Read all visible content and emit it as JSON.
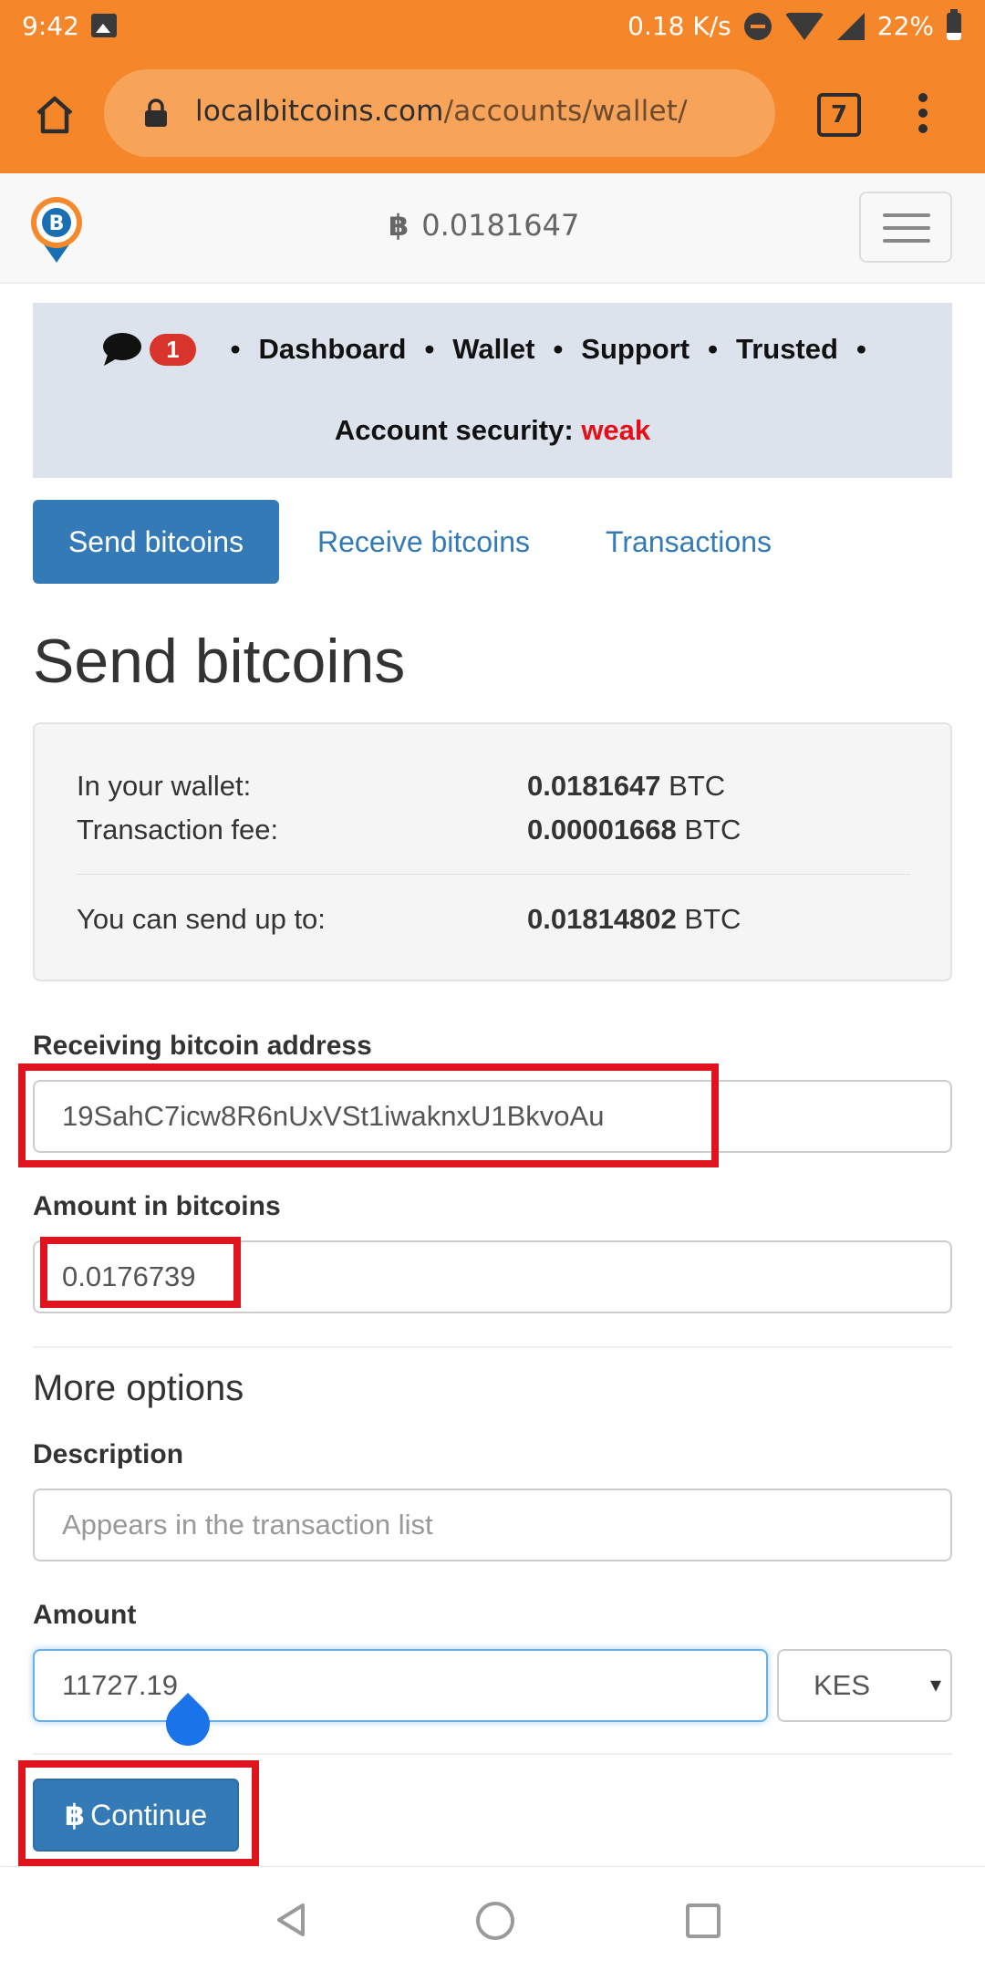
{
  "status_bar": {
    "time": "9:42",
    "net_speed": "0.18 K/s",
    "battery": "22%"
  },
  "browser": {
    "url_host": "localbitcoins.com",
    "url_path": "/accounts/wallet/",
    "tab_count": "7"
  },
  "navbar": {
    "balance_symbol": "฿",
    "balance": "0.0181647"
  },
  "info_nav": {
    "message_count": "1",
    "links": [
      "Dashboard",
      "Wallet",
      "Support",
      "Trusted"
    ],
    "security_label": "Account security:",
    "security_value": "weak"
  },
  "tabs": [
    {
      "label": "Send bitcoins",
      "active": true
    },
    {
      "label": "Receive bitcoins",
      "active": false
    },
    {
      "label": "Transactions",
      "active": false
    }
  ],
  "page_title": "Send bitcoins",
  "wallet_summary": {
    "in_wallet_label": "In your wallet:",
    "in_wallet_value": "0.0181647",
    "fee_label": "Transaction fee:",
    "fee_value": "0.00001668",
    "send_up_to_label": "You can send up to:",
    "send_up_to_value": "0.01814802",
    "unit": "BTC"
  },
  "form": {
    "address_label": "Receiving bitcoin address",
    "address_value": "19SahC7icw8R6nUxVSt1iwaknxU1BkvoAu",
    "amount_btc_label": "Amount in bitcoins",
    "amount_btc_value": "0.0176739",
    "more_options": "More options",
    "description_label": "Description",
    "description_placeholder": "Appears in the transaction list",
    "amount_label": "Amount",
    "amount_value": "11727.19",
    "currency": "KES",
    "currency_caret": "▾",
    "continue_label": "Continue",
    "continue_symbol": "฿"
  },
  "colors": {
    "toolbar": "#f5862a",
    "primary": "#337ab7",
    "annotation": "#e0141e",
    "weak": "#e3101a"
  }
}
